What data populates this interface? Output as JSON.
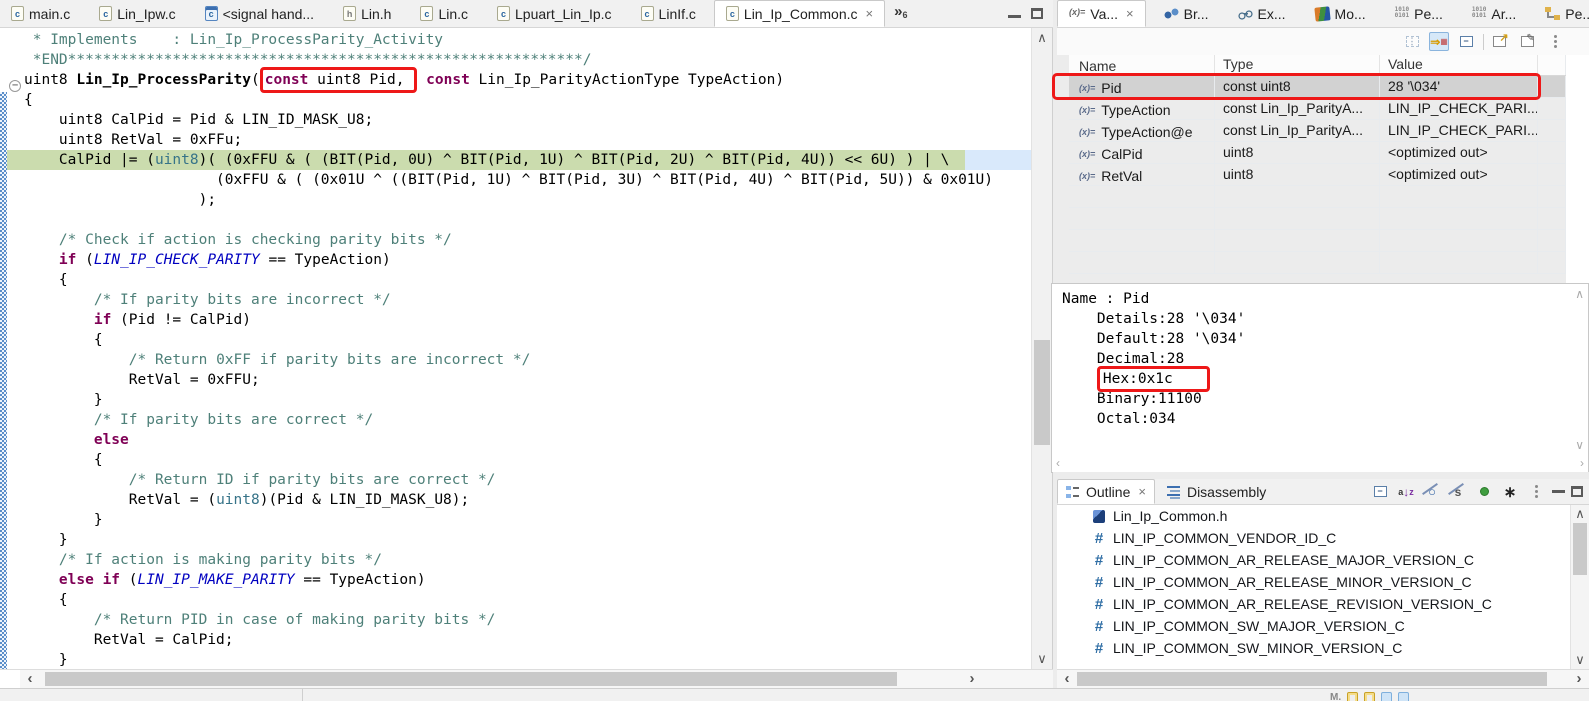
{
  "window": {
    "editor_tabs": [
      {
        "label": "main.c",
        "icon": "c"
      },
      {
        "label": "Lin_Ipw.c",
        "icon": "c"
      },
      {
        "label": "<signal hand...",
        "icon": "cw"
      },
      {
        "label": "Lin.h",
        "icon": "h"
      },
      {
        "label": "Lin.c",
        "icon": "c"
      },
      {
        "label": "Lpuart_Lin_Ip.c",
        "icon": "c"
      },
      {
        "label": "LinIf.c",
        "icon": "c"
      },
      {
        "label": "Lin_Ip_Common.c",
        "icon": "c",
        "active": true
      }
    ],
    "tab_overflow_count": "6"
  },
  "editor": {
    "code_lines": [
      {
        "s": [
          [
            "c",
            " * Implements    : Lin_Ip_ProcessParity_Activity"
          ]
        ]
      },
      {
        "s": [
          [
            "c",
            " *END***********************************************************/"
          ]
        ]
      },
      {
        "s": [
          [
            "p",
            "uint8 "
          ],
          [
            "f",
            "Lin_Ip_ProcessParity"
          ],
          [
            "p",
            "("
          ],
          [
            "B",
            [
              [
                "k",
                "const"
              ],
              [
                "p",
                " uint8 Pid,"
              ]
            ]
          ],
          [
            "p",
            " "
          ],
          [
            "k",
            "const"
          ],
          [
            "p",
            " Lin_Ip_ParityActionType TypeAction)"
          ]
        ]
      },
      {
        "s": [
          [
            "p",
            "{"
          ]
        ]
      },
      {
        "s": [
          [
            "p",
            "    uint8 CalPid = Pid & LIN_ID_MASK_U8;"
          ]
        ]
      },
      {
        "s": [
          [
            "p",
            "    uint8 RetVal = 0xFFu;"
          ]
        ]
      },
      {
        "x": true,
        "s": [
          [
            "p",
            "    CalPid |= ("
          ],
          [
            "t",
            "uint8"
          ],
          [
            "p",
            ")( (0xFFU & ( (BIT(Pid, 0U) ^ BIT(Pid, 1U) ^ BIT(Pid, 2U) ^ BIT(Pid, 4U)) << 6U) ) | \\"
          ]
        ]
      },
      {
        "s": [
          [
            "p",
            "                      (0xFFU & ( (0x01U ^ ((BIT(Pid, 1U) ^ BIT(Pid, 3U) ^ BIT(Pid, 4U) ^ BIT(Pid, 5U)) & 0x01U)"
          ]
        ]
      },
      {
        "s": [
          [
            "p",
            "                    );"
          ]
        ]
      },
      {
        "s": []
      },
      {
        "s": [
          [
            "p",
            "    "
          ],
          [
            "c",
            "/* Check if action is checking parity bits */"
          ]
        ]
      },
      {
        "s": [
          [
            "p",
            "    "
          ],
          [
            "k",
            "if"
          ],
          [
            "p",
            " ("
          ],
          [
            "m",
            "LIN_IP_CHECK_PARITY"
          ],
          [
            "p",
            " == TypeAction)"
          ]
        ]
      },
      {
        "s": [
          [
            "p",
            "    {"
          ]
        ]
      },
      {
        "s": [
          [
            "p",
            "        "
          ],
          [
            "c",
            "/* If parity bits are incorrect */"
          ]
        ]
      },
      {
        "s": [
          [
            "p",
            "        "
          ],
          [
            "k",
            "if"
          ],
          [
            "p",
            " (Pid != CalPid)"
          ]
        ]
      },
      {
        "s": [
          [
            "p",
            "        {"
          ]
        ]
      },
      {
        "s": [
          [
            "p",
            "            "
          ],
          [
            "c",
            "/* Return 0xFF if parity bits are incorrect */"
          ]
        ]
      },
      {
        "s": [
          [
            "p",
            "            RetVal = 0xFFU;"
          ]
        ]
      },
      {
        "s": [
          [
            "p",
            "        }"
          ]
        ]
      },
      {
        "s": [
          [
            "p",
            "        "
          ],
          [
            "c",
            "/* If parity bits are correct */"
          ]
        ]
      },
      {
        "s": [
          [
            "p",
            "        "
          ],
          [
            "k",
            "else"
          ]
        ]
      },
      {
        "s": [
          [
            "p",
            "        {"
          ]
        ]
      },
      {
        "s": [
          [
            "p",
            "            "
          ],
          [
            "c",
            "/* Return ID if parity bits are correct */"
          ]
        ]
      },
      {
        "s": [
          [
            "p",
            "            RetVal = ("
          ],
          [
            "t",
            "uint8"
          ],
          [
            "p",
            ")(Pid & LIN_ID_MASK_U8);"
          ]
        ]
      },
      {
        "s": [
          [
            "p",
            "        }"
          ]
        ]
      },
      {
        "s": [
          [
            "p",
            "    }"
          ]
        ]
      },
      {
        "s": [
          [
            "p",
            "    "
          ],
          [
            "c",
            "/* If action is making parity bits */"
          ]
        ]
      },
      {
        "s": [
          [
            "p",
            "    "
          ],
          [
            "k",
            "else"
          ],
          [
            "p",
            " "
          ],
          [
            "k",
            "if"
          ],
          [
            "p",
            " ("
          ],
          [
            "m",
            "LIN_IP_MAKE_PARITY"
          ],
          [
            "p",
            " == TypeAction)"
          ]
        ]
      },
      {
        "s": [
          [
            "p",
            "    {"
          ]
        ]
      },
      {
        "s": [
          [
            "p",
            "        "
          ],
          [
            "c",
            "/* Return PID in case of making parity bits */"
          ]
        ]
      },
      {
        "s": [
          [
            "p",
            "        RetVal = CalPid;"
          ]
        ]
      },
      {
        "s": [
          [
            "p",
            "    }"
          ]
        ]
      }
    ]
  },
  "variables": {
    "tabs": [
      {
        "label": "Va...",
        "icon": "variables",
        "active": true
      },
      {
        "label": "Br...",
        "icon": "breakpoints"
      },
      {
        "label": "Ex...",
        "icon": "expressions"
      },
      {
        "label": "Mo...",
        "icon": "modules"
      },
      {
        "label": "Pe...",
        "icon": "binary"
      },
      {
        "label": "Ar...",
        "icon": "binary"
      },
      {
        "label": "Pe...",
        "icon": "regtree"
      }
    ],
    "toolbar_icons": [
      "show-type-names-icon",
      "show-logical-structure-icon",
      "collapse-all-icon",
      "new-view-icon",
      "pin-view-icon",
      "view-menu-icon"
    ],
    "columns": [
      "Name",
      "Type",
      "Value"
    ],
    "rows": [
      {
        "name": "Pid",
        "type": "const uint8",
        "value": "28 '\\034'",
        "selected": true,
        "boxed": true
      },
      {
        "name": "TypeAction",
        "type": "const Lin_Ip_ParityA...",
        "value": "LIN_IP_CHECK_PARI..."
      },
      {
        "name": "TypeAction@e",
        "type": "const Lin_Ip_ParityA...",
        "value": "LIN_IP_CHECK_PARI..."
      },
      {
        "name": "CalPid",
        "type": "uint8",
        "value": "<optimized out>"
      },
      {
        "name": "RetVal",
        "type": "uint8",
        "value": "<optimized out>"
      },
      {},
      {},
      {},
      {}
    ],
    "details": [
      {
        "text": "Name : Pid"
      },
      {
        "text": "    Details:28 '\\034'"
      },
      {
        "text": "    Default:28 '\\034'"
      },
      {
        "text": "    Decimal:28"
      },
      {
        "text": "    ",
        "boxed": "Hex:0x1c"
      },
      {
        "text": "    Binary:11100"
      },
      {
        "text": "    Octal:034"
      }
    ]
  },
  "outline": {
    "tabs": [
      {
        "label": "Outline",
        "icon": "outline",
        "active": true
      },
      {
        "label": "Disassembly",
        "icon": "disassembly"
      }
    ],
    "toolbar_icons": [
      "collapse-all-icon",
      "sort-icon",
      "hide-fields-icon",
      "hide-static-members-icon",
      "hide-non-public-members-icon",
      "hide-inactive-directives-icon",
      "view-menu-icon"
    ],
    "items": [
      {
        "icon": "include",
        "label": "Lin_Ip_Common.h"
      },
      {
        "icon": "define",
        "label": "LIN_IP_COMMON_VENDOR_ID_C"
      },
      {
        "icon": "define",
        "label": "LIN_IP_COMMON_AR_RELEASE_MAJOR_VERSION_C"
      },
      {
        "icon": "define",
        "label": "LIN_IP_COMMON_AR_RELEASE_MINOR_VERSION_C"
      },
      {
        "icon": "define",
        "label": "LIN_IP_COMMON_AR_RELEASE_REVISION_VERSION_C"
      },
      {
        "icon": "define",
        "label": "LIN_IP_COMMON_SW_MAJOR_VERSION_C"
      },
      {
        "icon": "define",
        "label": "LIN_IP_COMMON_SW_MINOR_VERSION_C"
      }
    ]
  },
  "colors": {
    "annotation_red": "#ee1818",
    "exec_line_green": "#cbdcae",
    "keyword": "#7f0055",
    "macro_blue": "#0000c0",
    "comment_teal": "#4e8079",
    "selection_gray": "#d2d2d2"
  }
}
